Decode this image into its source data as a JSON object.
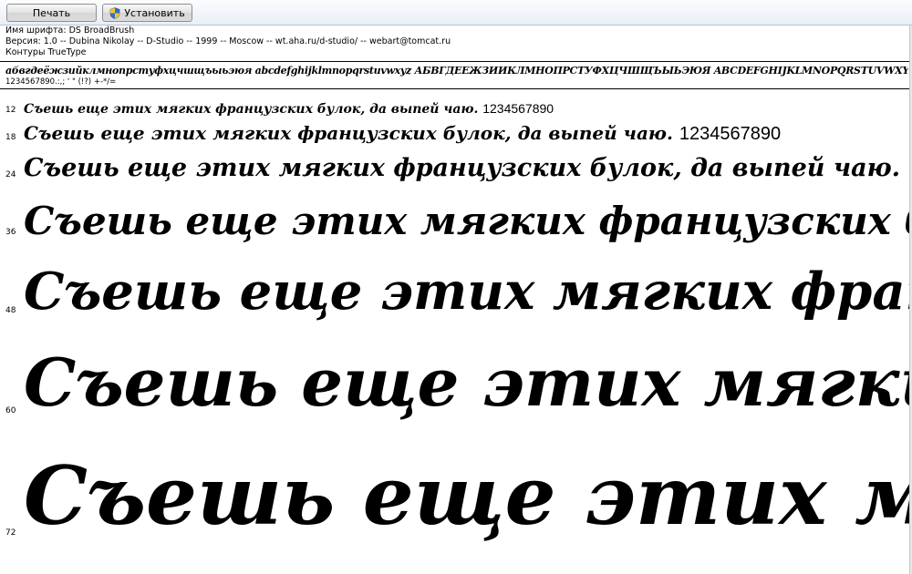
{
  "toolbar": {
    "print_label": "Печать",
    "install_label": "Установить"
  },
  "font_info": {
    "name_line": "Имя шрифта: DS BroadBrush",
    "version_line": "Версия: 1.0 -- Dubina Nikolay -- D-Studio -- 1999 -- Moscow -- wt.aha.ru/d-studio/ -- webart@tomcat.ru",
    "outline_line": "Контуры TrueType"
  },
  "charset": {
    "alphabet": "абвгдеёжзийклмнопрстуфхцчшщъыьэюя abcdefghijklmnopqrstuvwxyz АБВГДЕЁЖЗИЙКЛМНОПРСТУФХЦЧШЩЪЫЬЭЮЯ ABCDEFGHIJKLMNOPQRSTUVWXYZ",
    "digits": "1234567890.:,; ' \" (!?) +-*/="
  },
  "samples": [
    {
      "size": "12",
      "text": "Съешь еще этих мягких французских булок, да выпей чаю.",
      "digits": "1234567890"
    },
    {
      "size": "18",
      "text": "Съешь еще этих мягких французских булок, да выпей чаю.",
      "digits": "1234567890"
    },
    {
      "size": "24",
      "text": "Съешь еще этих мягких французских булок, да выпей чаю."
    },
    {
      "size": "36",
      "text": "Съешь еще этих мягких французских булок"
    },
    {
      "size": "48",
      "text": "Съешь еще этих мягких французских"
    },
    {
      "size": "60",
      "text": "Съешь еще этих мягких"
    },
    {
      "size": "72",
      "text": "Съешь еще этих мягких"
    }
  ]
}
